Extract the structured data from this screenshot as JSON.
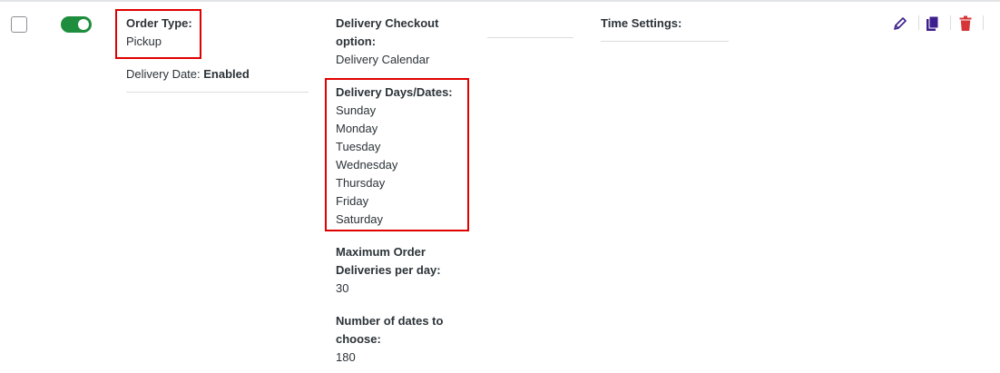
{
  "row": {
    "checkbox_checked": false,
    "toggle_on": true,
    "toggle_color": "#1e8e3e",
    "order_type": {
      "label": "Order Type:",
      "value": "Pickup"
    },
    "delivery_date": {
      "label": "Delivery Date:",
      "value": "Enabled"
    },
    "checkout_option": {
      "label_line1": "Delivery Checkout",
      "label_line2": "option:",
      "value": "Delivery Calendar"
    },
    "delivery_days": {
      "label": "Delivery Days/Dates:",
      "days": [
        "Sunday",
        "Monday",
        "Tuesday",
        "Wednesday",
        "Thursday",
        "Friday",
        "Saturday"
      ]
    },
    "max_orders": {
      "label_line1": "Maximum Order",
      "label_line2": "Deliveries per day:",
      "value": "30"
    },
    "dates_to_choose": {
      "label_line1": "Number of dates to",
      "label_line2": "choose:",
      "value": "180"
    },
    "time_settings": {
      "label": "Time Settings:"
    },
    "actions": {
      "edit_icon": "pencil-icon",
      "duplicate_icon": "duplicate-icon",
      "delete_icon": "trash-icon",
      "edit_color": "#3c1e8c",
      "delete_color": "#d63638"
    },
    "highlight_color": "#e00000"
  }
}
